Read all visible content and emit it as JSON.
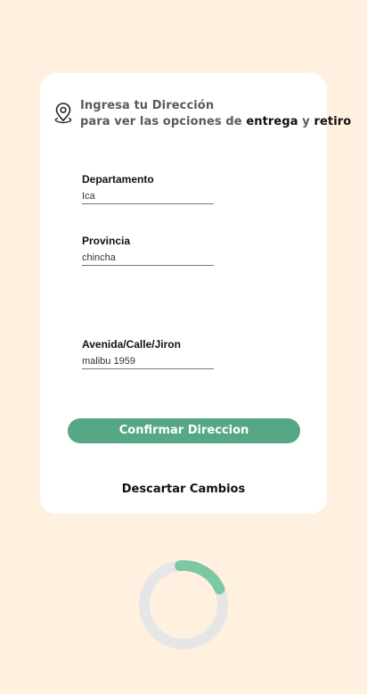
{
  "header": {
    "line1": "Ingresa tu Dirección",
    "line2_prefix": "para ver las opciones de ",
    "line2_delivery": "entrega",
    "line2_connector": " y ",
    "line2_pickup": "retiro"
  },
  "form": {
    "departamento": {
      "label": "Departamento",
      "value": "Ica"
    },
    "provincia": {
      "label": "Provincia",
      "value": "chincha"
    },
    "direccion": {
      "label": "Avenida/Calle/Jiron",
      "value": "malibu 1959"
    }
  },
  "actions": {
    "confirm_label": "Confirmar Direccion",
    "discard_label": "Descartar Cambios"
  },
  "colors": {
    "background": "#FFF0DF",
    "card": "#FFFFFF",
    "accent": "#55A883",
    "spinner_track": "#E6E6E6",
    "spinner_arc": "#7CC7A4"
  },
  "icons": {
    "location": "map-pin-icon"
  }
}
